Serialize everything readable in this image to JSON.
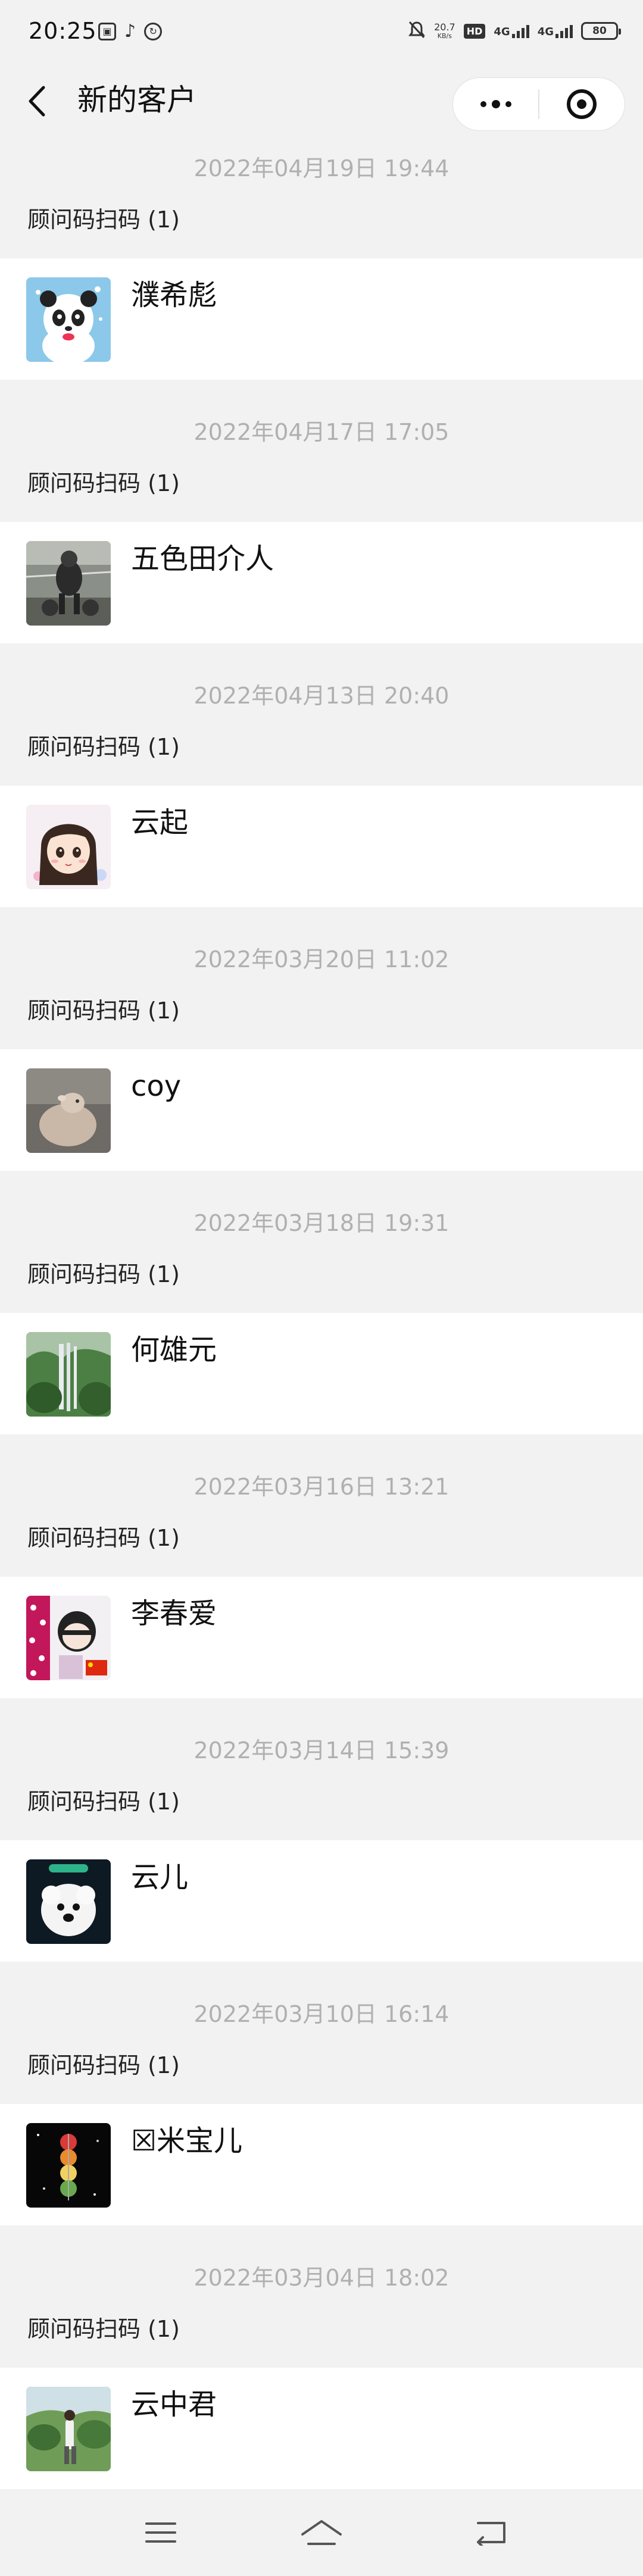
{
  "status_bar": {
    "time": "20:25",
    "net_speed_value": "20.7",
    "net_speed_unit": "KB/s",
    "hd_label": "HD",
    "network_1": "4G",
    "network_2": "4G",
    "battery": "80"
  },
  "nav": {
    "title": "新的客户"
  },
  "groups": [
    {
      "date": "2022年04月19日 19:44",
      "source": "顾问码扫码 (1)",
      "name": "濮希彪"
    },
    {
      "date": "2022年04月17日 17:05",
      "source": "顾问码扫码 (1)",
      "name": "五色田介人"
    },
    {
      "date": "2022年04月13日 20:40",
      "source": "顾问码扫码 (1)",
      "name": "云起"
    },
    {
      "date": "2022年03月20日 11:02",
      "source": "顾问码扫码 (1)",
      "name": "coy"
    },
    {
      "date": "2022年03月18日 19:31",
      "source": "顾问码扫码 (1)",
      "name": "何雄元"
    },
    {
      "date": "2022年03月16日 13:21",
      "source": "顾问码扫码 (1)",
      "name": "李春爱"
    },
    {
      "date": "2022年03月14日 15:39",
      "source": "顾问码扫码 (1)",
      "name": "云儿"
    },
    {
      "date": "2022年03月10日 16:14",
      "source": "顾问码扫码 (1)",
      "name": "☒米宝儿"
    },
    {
      "date": "2022年03月04日 18:02",
      "source": "顾问码扫码 (1)",
      "name": "云中君"
    }
  ],
  "icons": {
    "back": "chevron-left-icon",
    "more": "more-dots-icon",
    "close": "mini-program-close-icon",
    "menu": "menu-icon",
    "home": "home-icon",
    "recent": "back-arrow-icon"
  }
}
